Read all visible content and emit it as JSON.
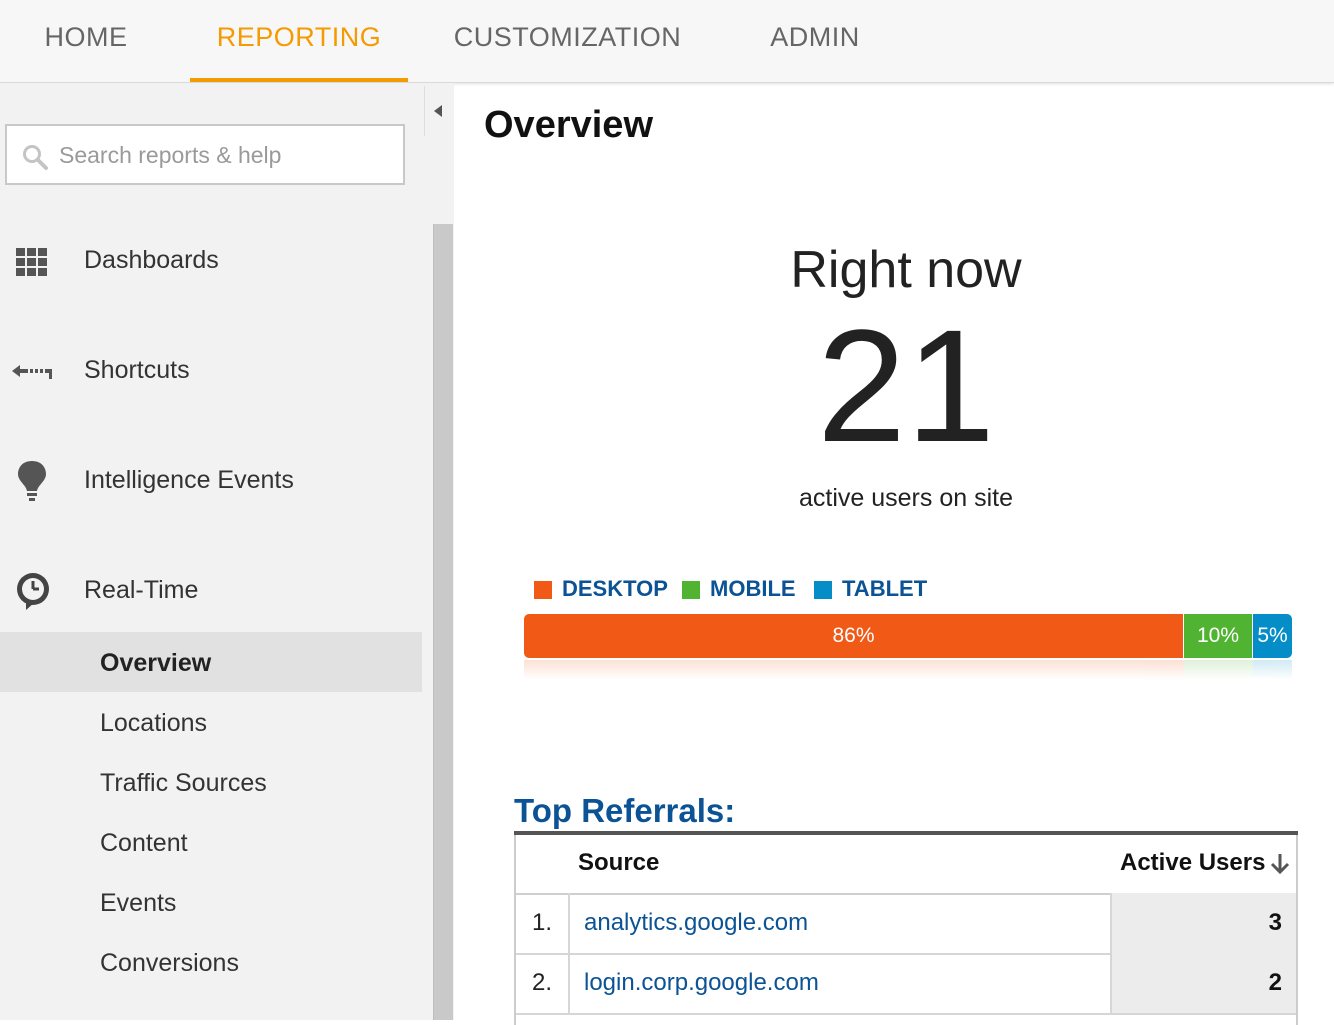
{
  "topnav": {
    "tabs": [
      {
        "label": "HOME"
      },
      {
        "label": "REPORTING"
      },
      {
        "label": "CUSTOMIZATION"
      },
      {
        "label": "ADMIN"
      }
    ],
    "active_tab": "REPORTING",
    "accent_color": "#f59a00"
  },
  "sidebar": {
    "search": {
      "placeholder": "Search reports & help",
      "value": "",
      "icon": "search-icon"
    },
    "collapse_icon": "chevron-left-icon",
    "items": [
      {
        "label": "Dashboards",
        "icon": "dashboard-grid-icon"
      },
      {
        "label": "Shortcuts",
        "icon": "shortcut-arrow-icon"
      },
      {
        "label": "Intelligence Events",
        "icon": "lightbulb-icon"
      },
      {
        "label": "Real-Time",
        "icon": "clock-icon"
      }
    ],
    "realtime_subitems": [
      {
        "label": "Overview",
        "active": true
      },
      {
        "label": "Locations"
      },
      {
        "label": "Traffic Sources"
      },
      {
        "label": "Content"
      },
      {
        "label": "Events"
      },
      {
        "label": "Conversions"
      }
    ]
  },
  "main": {
    "title": "Overview",
    "right_now_label": "Right now",
    "active_users": "21",
    "active_users_caption": "active users on site",
    "devices": {
      "legend": [
        {
          "label": "DESKTOP",
          "color": "#f05a16"
        },
        {
          "label": "MOBILE",
          "color": "#50b432"
        },
        {
          "label": "TABLET",
          "color": "#058dc7"
        }
      ],
      "segments": [
        {
          "label": "86%",
          "percent": 86,
          "color": "#f05a16"
        },
        {
          "label": "10%",
          "percent": 9,
          "color": "#50b432"
        },
        {
          "label": "5%",
          "percent": 5,
          "color": "#058dc7"
        }
      ]
    },
    "referrals": {
      "title": "Top Referrals:",
      "columns": {
        "source": "Source",
        "active_users": "Active Users"
      },
      "sort_icon": "arrow-down-icon",
      "rows": [
        {
          "rank": "1.",
          "source": "analytics.google.com",
          "users": "3"
        },
        {
          "rank": "2.",
          "source": "login.corp.google.com",
          "users": "2"
        }
      ]
    }
  }
}
